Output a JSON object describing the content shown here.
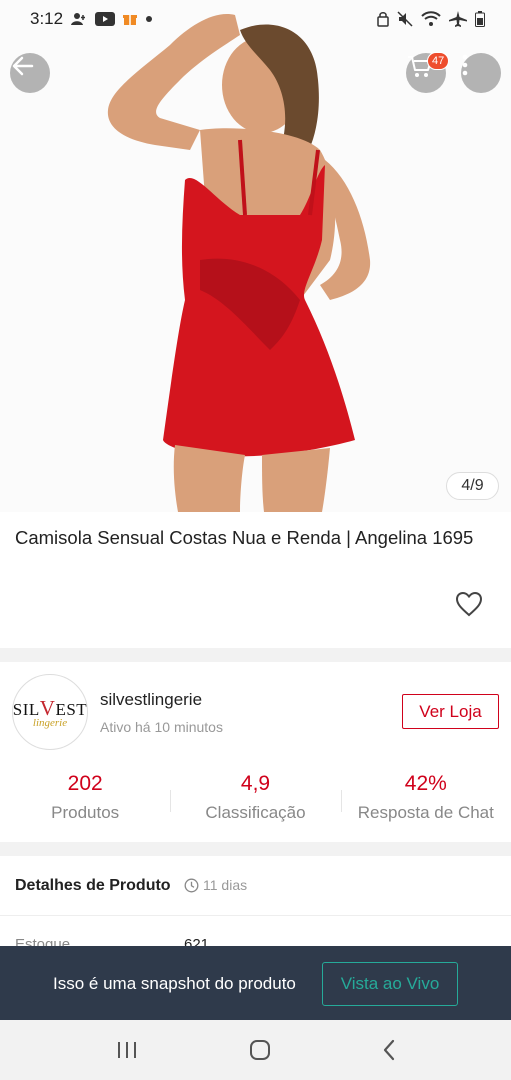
{
  "status_bar": {
    "time": "3:12",
    "left_icons": [
      "person-icon",
      "youtube-icon",
      "gift-icon",
      "dot-icon"
    ],
    "right_icons": [
      "lock-icon",
      "mute-icon",
      "wifi-icon",
      "airplane-icon",
      "battery-icon"
    ]
  },
  "header": {
    "cart_count": "47",
    "image_counter": "4/9"
  },
  "product": {
    "title": "Camisola Sensual Costas Nua e Renda | Angelina 1695"
  },
  "shop": {
    "logo_main_prefix": "SIL",
    "logo_main_v": "V",
    "logo_main_suffix": "EST",
    "logo_sub": "lingerie",
    "name": "silvestlingerie",
    "status": "Ativo há 10 minutos",
    "visit_label": "Ver Loja",
    "stats": [
      {
        "value": "202",
        "label": "Produtos"
      },
      {
        "value": "4,9",
        "label": "Classificação"
      },
      {
        "value": "42%",
        "label": "Resposta de Chat"
      }
    ]
  },
  "details": {
    "title": "Detalhes de Produto",
    "time": "11 dias",
    "stock_label": "Estoque",
    "stock_value": "621"
  },
  "snapshot": {
    "message": "Isso é uma snapshot do produto",
    "live_label": "Vista ao Vivo"
  },
  "colors": {
    "accent": "#d0011b",
    "badge": "#ee4d2d",
    "teal": "#26aa99",
    "snapshot_bg": "#2f3a4b"
  }
}
